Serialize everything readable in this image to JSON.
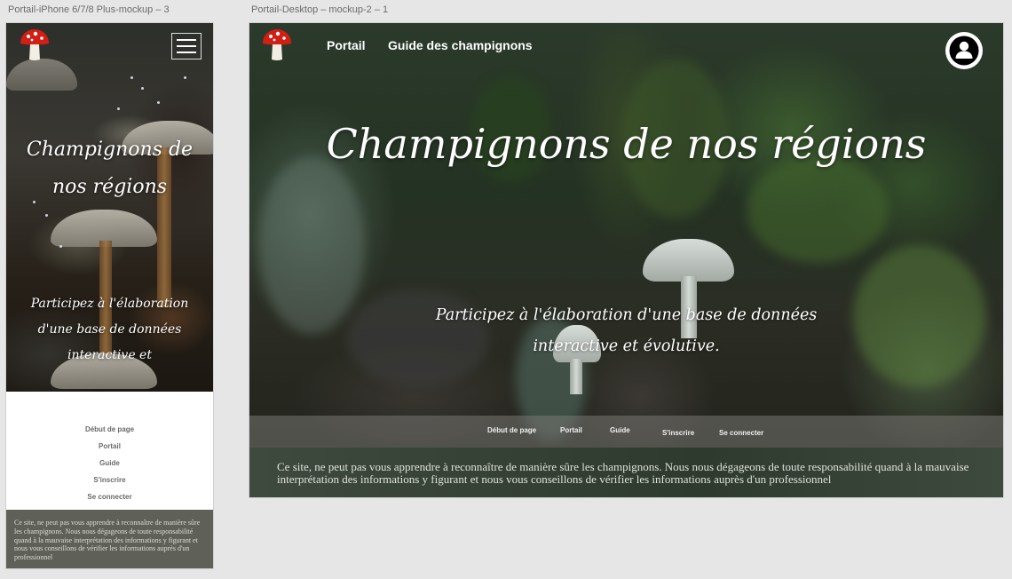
{
  "artboards": {
    "mobile_label": "Portail-iPhone 6/7/8 Plus-mockup – 3",
    "desktop_label": "Portail-Desktop – mockup-2 – 1"
  },
  "site": {
    "title": "Champignons de nos régions",
    "subtitle_desktop": "Participez à l'élaboration d'une base de données interactive et évolutive.",
    "subtitle_mobile": "Participez à l'élaboration d'une base de données interactive et",
    "disclaimer": "Ce site, ne peut pas vous apprendre à reconnaître de manière sûre les champignons. Nous nous dégageons de toute responsabilité quand à la mauvaise interprétation des informations y figurant et nous vous conseillons de vérifier les informations auprès d'un professionnel"
  },
  "header_nav": {
    "portail": "Portail",
    "guide": "Guide des champignons"
  },
  "footer_nav": {
    "top": "Début de page",
    "portail": "Portail",
    "guide": "Guide",
    "signup": "S'inscrire",
    "login": "Se connecter"
  },
  "icons": {
    "logo": "mushroom-logo-icon",
    "menu": "hamburger-menu-icon",
    "account": "user-account-icon"
  },
  "colors": {
    "mushroom_cap": "#d11f16",
    "mobile_disclaimer_bg": "#5f6158",
    "desktop_disclaimer_bg": "#2d3a2d"
  }
}
